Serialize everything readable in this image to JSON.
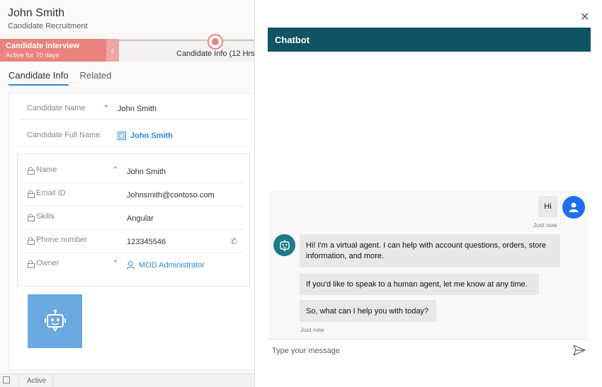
{
  "header": {
    "name": "John Smith",
    "subtitle": "Candidate Recruitment"
  },
  "process": {
    "active_stage": "Candidate Interview",
    "active_duration": "Active for 70 days",
    "next_stage_label": "Candidate Info  (12 Hrs"
  },
  "tabs": [
    {
      "label": "Candidate Info",
      "active": true
    },
    {
      "label": "Related",
      "active": false
    }
  ],
  "form": {
    "candidate_name_label": "Candidate Name",
    "candidate_name_value": "John Smith",
    "candidate_full_name_label": "Candidate Full Name",
    "candidate_full_name_value": "John Smith",
    "quick_view": [
      {
        "label": "Name",
        "value": "John Smith",
        "required": true
      },
      {
        "label": "Email ID",
        "value": "Johnsmith@contoso.com",
        "required": false
      },
      {
        "label": "Skills",
        "value": "Angular",
        "required": false
      },
      {
        "label": "Phone number",
        "value": "123345546",
        "required": false
      },
      {
        "label": "Owner",
        "value": "MOD Administrator",
        "required": true
      }
    ],
    "required_mark": "*"
  },
  "status": {
    "state": "Active"
  },
  "chatbot": {
    "close_glyph": "✕",
    "title": "Chatbot",
    "user_message": "Hi",
    "user_time": "Just now",
    "bot_messages": [
      "Hi! I'm a virtual agent. I can help with account questions, orders, store information, and more.",
      "If you'd like to speak to a human agent, let me know at any time.",
      "So, what can I help you with today?"
    ],
    "bot_time": "Just now",
    "input_placeholder": "Type your message"
  },
  "icons": {
    "close": "close-icon",
    "send": "send-icon",
    "user_avatar": "person-icon",
    "bot_avatar": "bot-icon",
    "lock": "lock-icon",
    "phone": "phone-icon",
    "chevron": "chevron-left-icon"
  },
  "colors": {
    "stage_active": "#e9837e",
    "chat_header": "#0f5465",
    "user_avatar": "#1b6ff2",
    "bot_avatar": "#1e7a85",
    "link": "#2b88d8"
  }
}
